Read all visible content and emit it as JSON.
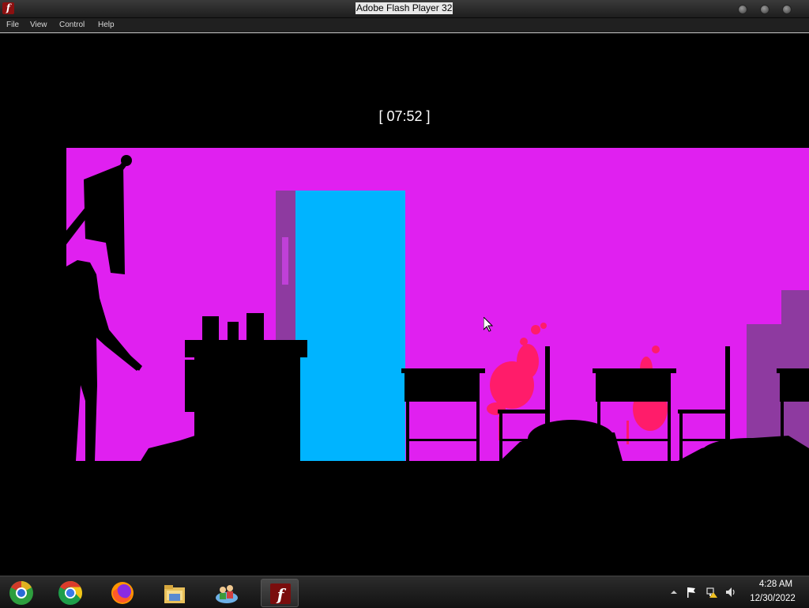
{
  "window": {
    "title": "Adobe Flash Player 32",
    "app_icon_glyph": "f"
  },
  "menu": {
    "items": [
      "File",
      "View",
      "Control",
      "Help"
    ]
  },
  "game": {
    "timer": "[ 07:52 ]",
    "background_color": "#e020f0",
    "door_color": "#00b4ff",
    "blood_color": "#ff1c6a"
  },
  "taskbar": {
    "apps": [
      {
        "name": "chrome-old-icon"
      },
      {
        "name": "chrome-icon"
      },
      {
        "name": "firefox-icon"
      },
      {
        "name": "file-explorer-icon"
      },
      {
        "name": "network-people-icon"
      },
      {
        "name": "flash-player-icon",
        "active": true
      }
    ],
    "clock": {
      "time": "4:28 AM",
      "date": "12/30/2022"
    }
  }
}
